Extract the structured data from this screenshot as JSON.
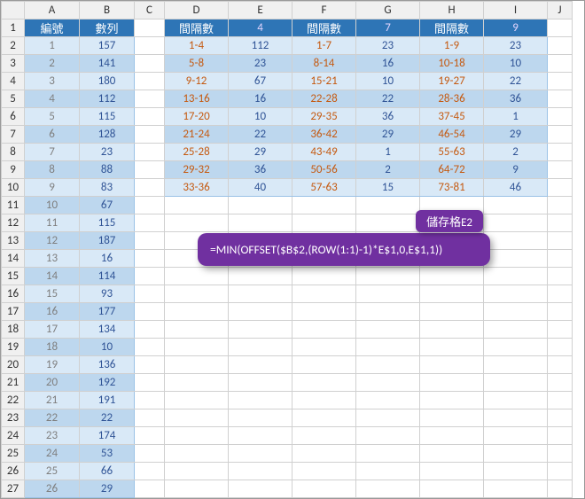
{
  "columns": [
    "",
    "A",
    "B",
    "C",
    "D",
    "E",
    "F",
    "G",
    "H",
    "I",
    "J"
  ],
  "leftHeader": {
    "A": "編號",
    "B": "數列"
  },
  "leftRows": [
    {
      "n": 1,
      "v": 157
    },
    {
      "n": 2,
      "v": 141
    },
    {
      "n": 3,
      "v": 180
    },
    {
      "n": 4,
      "v": 112
    },
    {
      "n": 5,
      "v": 115
    },
    {
      "n": 6,
      "v": 128
    },
    {
      "n": 7,
      "v": 23
    },
    {
      "n": 8,
      "v": 88
    },
    {
      "n": 9,
      "v": 83
    },
    {
      "n": 10,
      "v": 67
    },
    {
      "n": 11,
      "v": 115
    },
    {
      "n": 12,
      "v": 187
    },
    {
      "n": 13,
      "v": 16
    },
    {
      "n": 14,
      "v": 114
    },
    {
      "n": 15,
      "v": 93
    },
    {
      "n": 16,
      "v": 177
    },
    {
      "n": 17,
      "v": 134
    },
    {
      "n": 18,
      "v": 10
    },
    {
      "n": 19,
      "v": 136
    },
    {
      "n": 20,
      "v": 192
    },
    {
      "n": 21,
      "v": 191
    },
    {
      "n": 22,
      "v": 22
    },
    {
      "n": 23,
      "v": 174
    },
    {
      "n": 24,
      "v": 53
    },
    {
      "n": 25,
      "v": 66
    },
    {
      "n": 26,
      "v": 29
    }
  ],
  "rightHeader": {
    "D": "間隔數",
    "E": "4",
    "F": "間隔數",
    "G": "7",
    "H": "間隔數",
    "I": "9"
  },
  "rightRows": [
    {
      "D": "1-4",
      "E": 112,
      "F": "1-7",
      "G": 23,
      "H": "1-9",
      "I": 23
    },
    {
      "D": "5-8",
      "E": 23,
      "F": "8-14",
      "G": 16,
      "H": "10-18",
      "I": 10
    },
    {
      "D": "9-12",
      "E": 67,
      "F": "15-21",
      "G": 10,
      "H": "19-27",
      "I": 22
    },
    {
      "D": "13-16",
      "E": 16,
      "F": "22-28",
      "G": 22,
      "H": "28-36",
      "I": 36
    },
    {
      "D": "17-20",
      "E": 10,
      "F": "29-35",
      "G": 36,
      "H": "37-45",
      "I": 1
    },
    {
      "D": "21-24",
      "E": 22,
      "F": "36-42",
      "G": 29,
      "H": "46-54",
      "I": 29
    },
    {
      "D": "25-28",
      "E": 29,
      "F": "43-49",
      "G": 1,
      "H": "55-63",
      "I": 2
    },
    {
      "D": "29-32",
      "E": 36,
      "F": "50-56",
      "G": 2,
      "H": "64-72",
      "I": 9
    },
    {
      "D": "33-36",
      "E": 40,
      "F": "57-63",
      "G": 15,
      "H": "73-81",
      "I": 46
    }
  ],
  "callout": {
    "label": "儲存格E2",
    "formula": "=MIN(OFFSET($B$2,(ROW(1:1)-1)*E$1,0,E$1,1))"
  },
  "rowCount": 27
}
